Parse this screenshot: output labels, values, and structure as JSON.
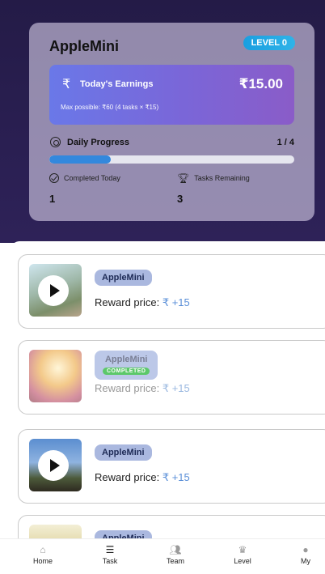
{
  "header": {
    "app_name": "AppleMini",
    "level_badge": "LEVEL 0",
    "earnings": {
      "currency_symbol": "₹",
      "label": "Today's Earnings",
      "amount": "₹15.00",
      "max_possible": "Max possible: ₹60 (4 tasks × ₹15)"
    },
    "progress": {
      "label": "Daily Progress",
      "count": "1 / 4",
      "fraction": 0.25
    },
    "completed": {
      "label": "Completed Today",
      "value": "1"
    },
    "remaining": {
      "label": "Tasks Remaining",
      "value": "3"
    }
  },
  "tasks": [
    {
      "title": "AppleMini",
      "reward_label": "Reward price:",
      "reward_amount": "₹ +15",
      "completed": false,
      "has_play": true
    },
    {
      "title": "AppleMini",
      "completed_tag": "COMPLETED",
      "reward_label": "Reward price:",
      "reward_amount": "₹ +15",
      "completed": true,
      "has_play": false
    },
    {
      "title": "AppleMini",
      "reward_label": "Reward price:",
      "reward_amount": "₹ +15",
      "completed": false,
      "has_play": true
    },
    {
      "title": "AppleMini",
      "completed": false,
      "has_play": false
    }
  ],
  "nav": {
    "items": [
      {
        "label": "Home",
        "icon": "home-icon",
        "active": false
      },
      {
        "label": "Task",
        "icon": "task-list-icon",
        "active": true
      },
      {
        "label": "Team",
        "icon": "team-icon",
        "active": false
      },
      {
        "label": "Level",
        "icon": "crown-icon",
        "active": false
      },
      {
        "label": "My",
        "icon": "person-icon",
        "active": false
      }
    ]
  },
  "colors": {
    "hero_bg": "#241b47",
    "earnings_gradient_start": "#6a78e8",
    "earnings_gradient_end": "#8a5cc8",
    "level_badge": "#1a9fe0",
    "progress_fill": "#3388dd",
    "completed_tag": "#5cc86a",
    "reward_amount": "#5a8fd8"
  }
}
